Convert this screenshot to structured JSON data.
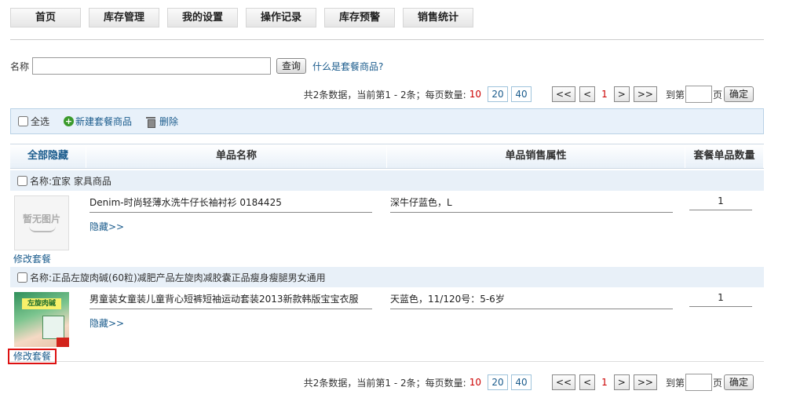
{
  "nav": {
    "tabs": [
      {
        "label": "首页"
      },
      {
        "label": "库存管理"
      },
      {
        "label": "我的设置"
      },
      {
        "label": "操作记录"
      },
      {
        "label": "库存预警"
      },
      {
        "label": "销售统计"
      }
    ]
  },
  "search": {
    "label": "名称",
    "value": "",
    "button": "查询",
    "help_link": "什么是套餐商品?"
  },
  "pager": {
    "summary": "共2条数据，当前第1 - 2条；每页数量:",
    "current_size": "10",
    "sizes": [
      "20",
      "40"
    ],
    "first": "<<",
    "prev": "<",
    "current_page": "1",
    "next": ">",
    "last": ">>",
    "goto_prefix": "到第",
    "goto_suffix": "页",
    "confirm": "确定"
  },
  "toolbar": {
    "select_all": "全选",
    "new_package": "新建套餐商品",
    "delete": "删除"
  },
  "table": {
    "headers": {
      "hide_all": "全部隐藏",
      "item_name": "单品名称",
      "sale_attr": "单品销售属性",
      "qty": "套餐单品数量"
    },
    "groups": [
      {
        "name": "名称:宜家 家具商品",
        "no_image_text": "暂无图片",
        "edit": "修改套餐",
        "items": [
          {
            "name": "Denim-时尚轻薄水洗牛仔长袖衬衫 0184425",
            "attr": "深牛仔蓝色，L",
            "qty": "1",
            "hide": "隐藏>>"
          }
        ]
      },
      {
        "name": "名称:正品左旋肉碱(60粒)减肥产品左旋肉减胶囊正品瘦身瘦腿男女通用",
        "product_image_text": "左旋肉碱",
        "edit": "修改套餐",
        "items": [
          {
            "name": "男童装女童装儿童背心短裤短袖运动套装2013新款韩版宝宝衣服",
            "attr": "天蓝色，11/120号：5-6岁",
            "qty": "1",
            "hide": "隐藏>>"
          }
        ]
      }
    ]
  }
}
